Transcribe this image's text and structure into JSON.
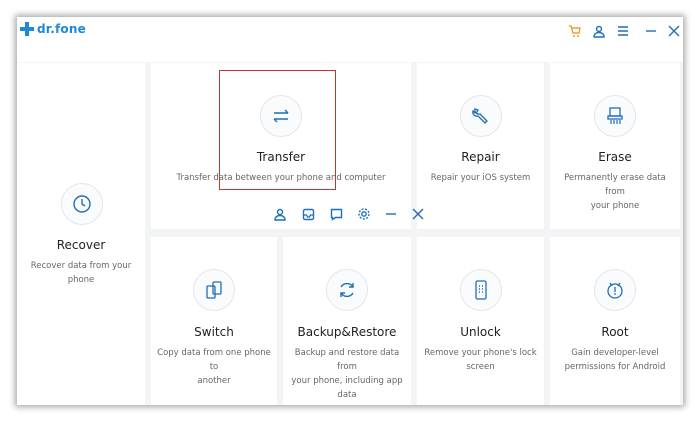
{
  "app": {
    "title": "dr.fone"
  },
  "titlebar_icons": [
    "cart-icon",
    "user-icon",
    "menu-icon",
    "minimize-icon",
    "close-icon"
  ],
  "colors": {
    "accent": "#1e88d9",
    "cart": "#f0a030",
    "icon_stroke": "#1e6eb8",
    "selection": "#c0392b"
  },
  "tiles": {
    "recover": {
      "title": "Recover",
      "desc": "Recover data from your phone"
    },
    "transfer": {
      "title": "Transfer",
      "desc": "Transfer data between your phone and computer"
    },
    "repair": {
      "title": "Repair",
      "desc": "Repair your iOS system"
    },
    "erase": {
      "title": "Erase",
      "desc1": "Permanently erase data from",
      "desc2": "your phone"
    },
    "switch": {
      "title": "Switch",
      "desc1": "Copy data from one phone to",
      "desc2": "another"
    },
    "backup": {
      "title": "Backup&Restore",
      "desc1": "Backup and restore data from",
      "desc2": "your phone, including app data"
    },
    "unlock": {
      "title": "Unlock",
      "desc1": "Remove your phone's lock",
      "desc2": "screen"
    },
    "root": {
      "title": "Root",
      "desc1": "Gain developer-level",
      "desc2": "permissions for Android"
    }
  },
  "floating_toolbar_icons": [
    "user-icon",
    "inbox-icon",
    "chat-icon",
    "settings-icon",
    "minimize-icon",
    "close-icon"
  ]
}
